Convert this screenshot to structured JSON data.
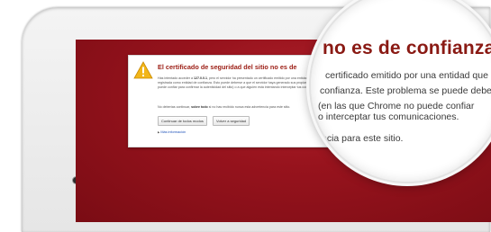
{
  "warning": {
    "title": "El certificado de seguridad del sitio no es de",
    "body_1": "Has intentado acceder a ",
    "host": "127.0.0.1",
    "body_2": ", pero el servidor ha presentado un certificado emitido por una entidad que el sistema operativo del ordenador no tiene registrada como entidad de confianza. Esto puede deberse a que el servidor haya generado sus propias credenciales de seguridad (en las que Chrome no puede confiar para confirmar la autenticidad del sitio) o a que alguien está intentando interceptar tus comunicaciones.",
    "continue_1": "No deberías continuar, ",
    "continue_bold": "sobre todo",
    "continue_2": " si no has recibido nunca esta advertencia para este sitio.",
    "proceed_label": "Continuar de todos modos",
    "back_label": "Volver a seguridad",
    "more_info_label": "Más información"
  },
  "magnifier": {
    "title": "no es de confianza.",
    "line1": "certificado emitido por una entidad que el",
    "line2": "confianza. Este problema se puede deber",
    "line3": "(en las que Chrome no puede confiar",
    "line3b": "o interceptar tus comunicaciones.",
    "line4": "ncia para este sitio."
  },
  "colors": {
    "screen_red": "#97131d",
    "title_red": "#9b1c13",
    "link_blue": "#1c50b8",
    "warning_yellow": "#f2b619"
  },
  "icons": {
    "warning": "warning-triangle-icon",
    "disclosure": "disclosure-triangle-icon"
  }
}
